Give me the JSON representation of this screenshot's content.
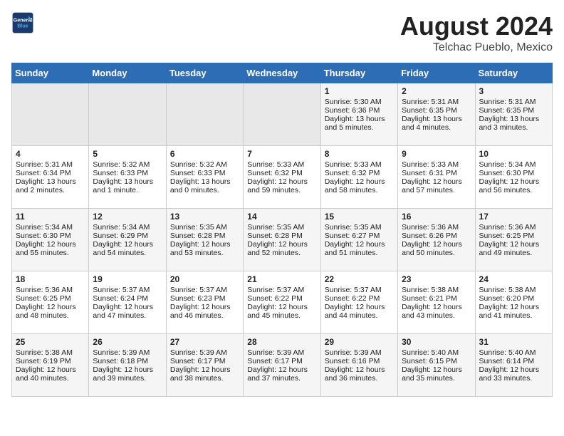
{
  "header": {
    "logo_line1": "General",
    "logo_line2": "Blue",
    "title": "August 2024",
    "subtitle": "Telchac Pueblo, Mexico"
  },
  "columns": [
    "Sunday",
    "Monday",
    "Tuesday",
    "Wednesday",
    "Thursday",
    "Friday",
    "Saturday"
  ],
  "weeks": [
    {
      "days": [
        {
          "num": "",
          "info": "",
          "empty": true
        },
        {
          "num": "",
          "info": "",
          "empty": true
        },
        {
          "num": "",
          "info": "",
          "empty": true
        },
        {
          "num": "",
          "info": "",
          "empty": true
        },
        {
          "num": "1",
          "info": "Sunrise: 5:30 AM\nSunset: 6:36 PM\nDaylight: 13 hours\nand 5 minutes."
        },
        {
          "num": "2",
          "info": "Sunrise: 5:31 AM\nSunset: 6:35 PM\nDaylight: 13 hours\nand 4 minutes."
        },
        {
          "num": "3",
          "info": "Sunrise: 5:31 AM\nSunset: 6:35 PM\nDaylight: 13 hours\nand 3 minutes."
        }
      ]
    },
    {
      "days": [
        {
          "num": "4",
          "info": "Sunrise: 5:31 AM\nSunset: 6:34 PM\nDaylight: 13 hours\nand 2 minutes."
        },
        {
          "num": "5",
          "info": "Sunrise: 5:32 AM\nSunset: 6:33 PM\nDaylight: 13 hours\nand 1 minute."
        },
        {
          "num": "6",
          "info": "Sunrise: 5:32 AM\nSunset: 6:33 PM\nDaylight: 13 hours\nand 0 minutes."
        },
        {
          "num": "7",
          "info": "Sunrise: 5:33 AM\nSunset: 6:32 PM\nDaylight: 12 hours\nand 59 minutes."
        },
        {
          "num": "8",
          "info": "Sunrise: 5:33 AM\nSunset: 6:32 PM\nDaylight: 12 hours\nand 58 minutes."
        },
        {
          "num": "9",
          "info": "Sunrise: 5:33 AM\nSunset: 6:31 PM\nDaylight: 12 hours\nand 57 minutes."
        },
        {
          "num": "10",
          "info": "Sunrise: 5:34 AM\nSunset: 6:30 PM\nDaylight: 12 hours\nand 56 minutes."
        }
      ]
    },
    {
      "days": [
        {
          "num": "11",
          "info": "Sunrise: 5:34 AM\nSunset: 6:30 PM\nDaylight: 12 hours\nand 55 minutes."
        },
        {
          "num": "12",
          "info": "Sunrise: 5:34 AM\nSunset: 6:29 PM\nDaylight: 12 hours\nand 54 minutes."
        },
        {
          "num": "13",
          "info": "Sunrise: 5:35 AM\nSunset: 6:28 PM\nDaylight: 12 hours\nand 53 minutes."
        },
        {
          "num": "14",
          "info": "Sunrise: 5:35 AM\nSunset: 6:28 PM\nDaylight: 12 hours\nand 52 minutes."
        },
        {
          "num": "15",
          "info": "Sunrise: 5:35 AM\nSunset: 6:27 PM\nDaylight: 12 hours\nand 51 minutes."
        },
        {
          "num": "16",
          "info": "Sunrise: 5:36 AM\nSunset: 6:26 PM\nDaylight: 12 hours\nand 50 minutes."
        },
        {
          "num": "17",
          "info": "Sunrise: 5:36 AM\nSunset: 6:25 PM\nDaylight: 12 hours\nand 49 minutes."
        }
      ]
    },
    {
      "days": [
        {
          "num": "18",
          "info": "Sunrise: 5:36 AM\nSunset: 6:25 PM\nDaylight: 12 hours\nand 48 minutes."
        },
        {
          "num": "19",
          "info": "Sunrise: 5:37 AM\nSunset: 6:24 PM\nDaylight: 12 hours\nand 47 minutes."
        },
        {
          "num": "20",
          "info": "Sunrise: 5:37 AM\nSunset: 6:23 PM\nDaylight: 12 hours\nand 46 minutes."
        },
        {
          "num": "21",
          "info": "Sunrise: 5:37 AM\nSunset: 6:22 PM\nDaylight: 12 hours\nand 45 minutes."
        },
        {
          "num": "22",
          "info": "Sunrise: 5:37 AM\nSunset: 6:22 PM\nDaylight: 12 hours\nand 44 minutes."
        },
        {
          "num": "23",
          "info": "Sunrise: 5:38 AM\nSunset: 6:21 PM\nDaylight: 12 hours\nand 43 minutes."
        },
        {
          "num": "24",
          "info": "Sunrise: 5:38 AM\nSunset: 6:20 PM\nDaylight: 12 hours\nand 41 minutes."
        }
      ]
    },
    {
      "days": [
        {
          "num": "25",
          "info": "Sunrise: 5:38 AM\nSunset: 6:19 PM\nDaylight: 12 hours\nand 40 minutes."
        },
        {
          "num": "26",
          "info": "Sunrise: 5:39 AM\nSunset: 6:18 PM\nDaylight: 12 hours\nand 39 minutes."
        },
        {
          "num": "27",
          "info": "Sunrise: 5:39 AM\nSunset: 6:17 PM\nDaylight: 12 hours\nand 38 minutes."
        },
        {
          "num": "28",
          "info": "Sunrise: 5:39 AM\nSunset: 6:17 PM\nDaylight: 12 hours\nand 37 minutes."
        },
        {
          "num": "29",
          "info": "Sunrise: 5:39 AM\nSunset: 6:16 PM\nDaylight: 12 hours\nand 36 minutes."
        },
        {
          "num": "30",
          "info": "Sunrise: 5:40 AM\nSunset: 6:15 PM\nDaylight: 12 hours\nand 35 minutes."
        },
        {
          "num": "31",
          "info": "Sunrise: 5:40 AM\nSunset: 6:14 PM\nDaylight: 12 hours\nand 33 minutes."
        }
      ]
    }
  ]
}
